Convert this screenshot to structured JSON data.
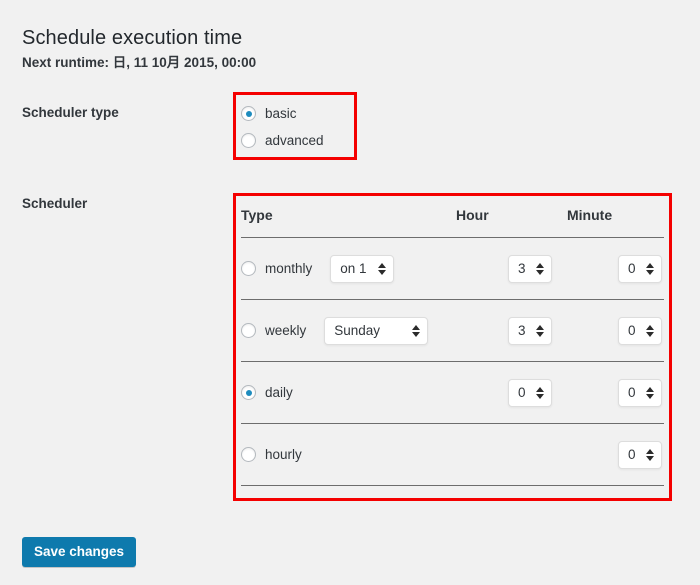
{
  "page": {
    "title": "Schedule execution time",
    "next_runtime": "Next runtime: 日, 11 10月 2015, 00:00"
  },
  "scheduler_type": {
    "label": "Scheduler type",
    "options": [
      {
        "label": "basic",
        "selected": true
      },
      {
        "label": "advanced",
        "selected": false
      }
    ]
  },
  "scheduler": {
    "label": "Scheduler",
    "headers": {
      "type": "Type",
      "hour": "Hour",
      "minute": "Minute"
    },
    "rows": [
      {
        "name": "monthly",
        "selected": false,
        "extra_select": "on 1",
        "hour": "3",
        "minute": "0"
      },
      {
        "name": "weekly",
        "selected": false,
        "extra_select": "Sunday",
        "hour": "3",
        "minute": "0"
      },
      {
        "name": "daily",
        "selected": true,
        "extra_select": null,
        "hour": "0",
        "minute": "0"
      },
      {
        "name": "hourly",
        "selected": false,
        "extra_select": null,
        "hour": null,
        "minute": "0"
      }
    ]
  },
  "actions": {
    "save_label": "Save changes"
  },
  "colors": {
    "background": "#f1f1f1",
    "text": "#32373c",
    "heading": "#23282d",
    "accent_blue": "#1e8cbe",
    "button_blue": "#0e7aad",
    "annotation_red": "#f40000",
    "rule_gray": "#6d6d6d"
  }
}
